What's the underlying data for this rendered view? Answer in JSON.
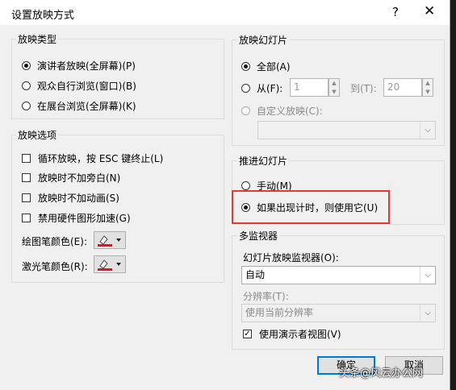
{
  "title": "设置放映方式",
  "titlebar": {
    "help": "?",
    "close": "✕"
  },
  "show_type": {
    "title": "放映类型",
    "options": [
      {
        "label": "演讲者放映(全屏幕)(P)",
        "checked": true
      },
      {
        "label": "观众自行浏览(窗口)(B)",
        "checked": false
      },
      {
        "label": "在展台浏览(全屏幕)(K)",
        "checked": false
      }
    ]
  },
  "show_options": {
    "title": "放映选项",
    "checks": [
      {
        "label": "循环放映，按 ESC 键终止(L)"
      },
      {
        "label": "放映时不加旁白(N)"
      },
      {
        "label": "放映时不加动画(S)"
      },
      {
        "label": "禁用硬件图形加速(G)"
      }
    ],
    "pen_color_label": "绘图笔颜色(E):",
    "laser_color_label": "激光笔颜色(R):",
    "pen_color": "#e81123",
    "laser_color": "#e81123"
  },
  "slides": {
    "title": "放映幻灯片",
    "all_label": "全部(A)",
    "from_label": "从(F):",
    "from_value": "1",
    "to_label": "到(T):",
    "to_value": "20",
    "custom_label": "自定义放映(C):"
  },
  "advance": {
    "title": "推进幻灯片",
    "manual_label": "手动(M)",
    "timing_label": "如果出现计时，则使用它(U)"
  },
  "monitors": {
    "title": "多监视器",
    "monitor_label": "幻灯片放映监视器(O):",
    "monitor_value": "自动",
    "resolution_label": "分辨率(T):",
    "resolution_value": "使用当前分辨率",
    "presenter_view_label": "使用演示者视图(V)"
  },
  "buttons": {
    "ok": "确定",
    "cancel": "取消"
  },
  "watermark": "头条@风云办公网",
  "colors": {
    "highlight": "#e53935",
    "accent": "#0078d7"
  }
}
